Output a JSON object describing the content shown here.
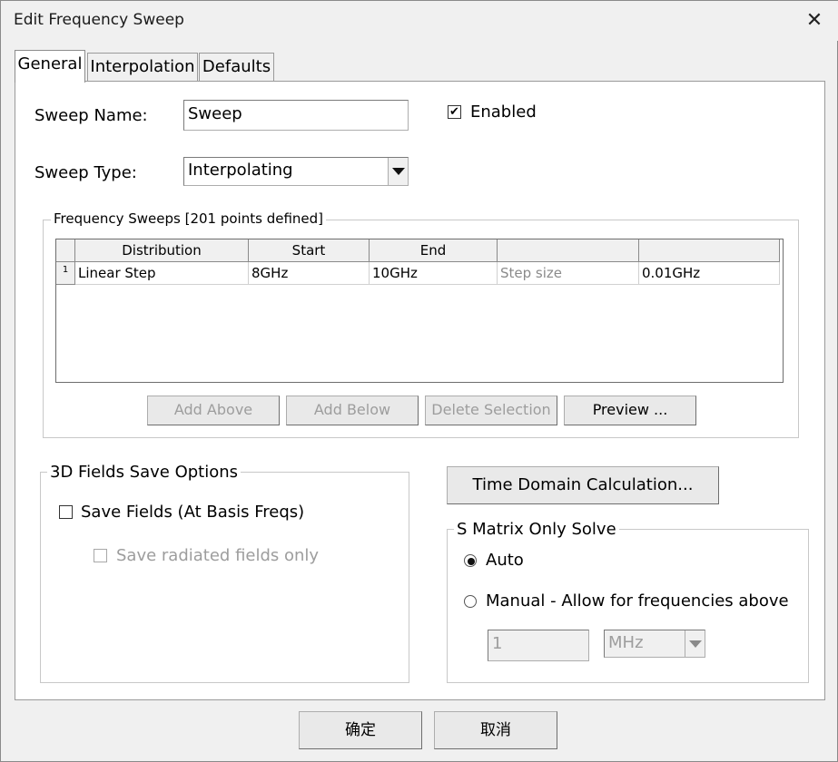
{
  "window": {
    "title": "Edit Frequency Sweep",
    "close_icon": "close-icon"
  },
  "tabs": [
    {
      "label": "General"
    },
    {
      "label": "Interpolation"
    },
    {
      "label": "Defaults"
    }
  ],
  "general": {
    "sweep_name_label": "Sweep Name:",
    "sweep_name_value": "Sweep",
    "enabled_label": "Enabled",
    "enabled_checked": true,
    "sweep_type_label": "Sweep Type:",
    "sweep_type_value": "Interpolating"
  },
  "frequency_sweeps": {
    "title": "Frequency Sweeps [201 points defined]",
    "columns": [
      "Distribution",
      "Start",
      "End",
      "",
      ""
    ],
    "rows": [
      {
        "index": "1",
        "distribution": "Linear Step",
        "start": "8GHz",
        "end": "10GHz",
        "param_label": "Step size",
        "param_value": "0.01GHz"
      }
    ],
    "buttons": {
      "add_above": "Add Above",
      "add_below": "Add Below",
      "delete_selection": "Delete Selection",
      "preview": "Preview ..."
    }
  },
  "fields_save": {
    "title": "3D Fields Save Options",
    "save_fields_label": "Save Fields (At Basis Freqs)",
    "save_fields_checked": false,
    "save_radiated_label": "Save radiated fields only",
    "save_radiated_checked": false
  },
  "time_domain_button": "Time Domain Calculation...",
  "s_matrix": {
    "title": "S Matrix Only Solve",
    "auto_label": "Auto",
    "auto_selected": true,
    "manual_label": "Manual -  Allow for frequencies above",
    "manual_value": "1",
    "manual_unit": "MHz"
  },
  "footer": {
    "ok_label": "确定",
    "cancel_label": "取消"
  }
}
